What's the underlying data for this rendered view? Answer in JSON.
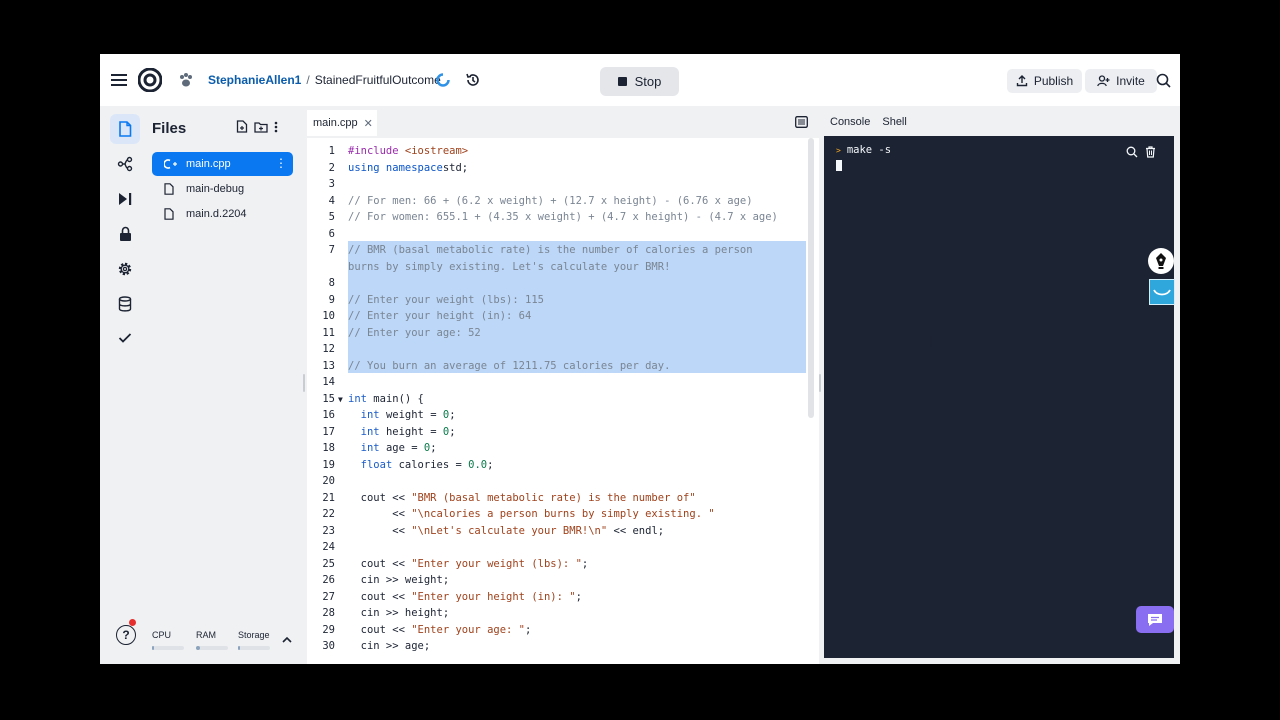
{
  "header": {
    "user": "StephanieAllen1",
    "separator": "/",
    "repl_name": "StainedFruitfulOutcome",
    "stop_label": "Stop",
    "publish_label": "Publish",
    "invite_label": "Invite"
  },
  "files": {
    "title": "Files",
    "items": [
      {
        "name": "main.cpp",
        "selected": true,
        "icon": "cpp-icon"
      },
      {
        "name": "main-debug",
        "selected": false,
        "icon": "file-icon"
      },
      {
        "name": "main.d.2204",
        "selected": false,
        "icon": "file-icon"
      }
    ]
  },
  "resources": {
    "cpu_label": "CPU",
    "ram_label": "RAM",
    "storage_label": "Storage",
    "cpu": 0.05,
    "ram": 0.12,
    "storage": 0.05
  },
  "editor": {
    "tab_label": "main.cpp",
    "selected_lines": [
      7,
      8,
      9,
      10,
      11,
      12,
      13
    ],
    "lines": [
      {
        "n": "1",
        "segs": [
          [
            "pp",
            "#include "
          ],
          [
            "st",
            "<iostream>"
          ]
        ]
      },
      {
        "n": "2",
        "segs": [
          [
            "kw",
            "using namespace"
          ],
          [
            "",
            "std;"
          ]
        ]
      },
      {
        "n": "3",
        "segs": []
      },
      {
        "n": "4",
        "segs": [
          [
            "cm",
            "// For men: 66 + (6.2 x weight) + (12.7 x height) - (6.76 x age)"
          ]
        ]
      },
      {
        "n": "5",
        "segs": [
          [
            "cm",
            "// For women: 655.1 + (4.35 x weight) + (4.7 x height) - (4.7 x age)"
          ]
        ]
      },
      {
        "n": "6",
        "segs": []
      },
      {
        "n": "7",
        "segs": [
          [
            "cm",
            "// BMR (basal metabolic rate) is the number of calories a person"
          ]
        ]
      },
      {
        "n": "",
        "segs": [
          [
            "cm",
            "burns by simply existing. Let's calculate your BMR!"
          ]
        ]
      },
      {
        "n": "8",
        "segs": []
      },
      {
        "n": "9",
        "segs": [
          [
            "cm",
            "// Enter your weight (lbs): 115"
          ]
        ]
      },
      {
        "n": "10",
        "segs": [
          [
            "cm",
            "// Enter your height (in): 64"
          ]
        ]
      },
      {
        "n": "11",
        "segs": [
          [
            "cm",
            "// Enter your age: 52"
          ]
        ]
      },
      {
        "n": "12",
        "segs": []
      },
      {
        "n": "13",
        "segs": [
          [
            "cm",
            "// You burn an average of 1211.75 calories per day."
          ]
        ]
      },
      {
        "n": "14",
        "segs": []
      },
      {
        "n": "15",
        "segs": [
          [
            "ty",
            "int "
          ],
          [
            "",
            "main() {"
          ]
        ]
      },
      {
        "n": "16",
        "segs": [
          [
            "",
            "  "
          ],
          [
            "ty",
            "int "
          ],
          [
            "",
            "weight = "
          ],
          [
            "nm",
            "0"
          ],
          [
            "",
            ";"
          ]
        ]
      },
      {
        "n": "17",
        "segs": [
          [
            "",
            "  "
          ],
          [
            "ty",
            "int "
          ],
          [
            "",
            "height = "
          ],
          [
            "nm",
            "0"
          ],
          [
            "",
            ";"
          ]
        ]
      },
      {
        "n": "18",
        "segs": [
          [
            "",
            "  "
          ],
          [
            "ty",
            "int "
          ],
          [
            "",
            "age = "
          ],
          [
            "nm",
            "0"
          ],
          [
            "",
            ";"
          ]
        ]
      },
      {
        "n": "19",
        "segs": [
          [
            "",
            "  "
          ],
          [
            "ty",
            "float "
          ],
          [
            "",
            "calories = "
          ],
          [
            "nm",
            "0.0"
          ],
          [
            "",
            ";"
          ]
        ]
      },
      {
        "n": "20",
        "segs": []
      },
      {
        "n": "21",
        "segs": [
          [
            "",
            "  cout << "
          ],
          [
            "st",
            "\"BMR (basal metabolic rate) is the number of\""
          ]
        ]
      },
      {
        "n": "22",
        "segs": [
          [
            "",
            "       << "
          ],
          [
            "st",
            "\"\\ncalories a person burns by simply existing. \""
          ]
        ]
      },
      {
        "n": "23",
        "segs": [
          [
            "",
            "       << "
          ],
          [
            "st",
            "\"\\nLet's calculate your BMR!\\n\""
          ],
          [
            "",
            " << endl;"
          ]
        ]
      },
      {
        "n": "24",
        "segs": []
      },
      {
        "n": "25",
        "segs": [
          [
            "",
            "  cout << "
          ],
          [
            "st",
            "\"Enter your weight (lbs): \""
          ],
          [
            "",
            ";"
          ]
        ]
      },
      {
        "n": "26",
        "segs": [
          [
            "",
            "  cin >> weight;"
          ]
        ]
      },
      {
        "n": "27",
        "segs": [
          [
            "",
            "  cout << "
          ],
          [
            "st",
            "\"Enter your height (in): \""
          ],
          [
            "",
            ";"
          ]
        ]
      },
      {
        "n": "28",
        "segs": [
          [
            "",
            "  cin >> height;"
          ]
        ]
      },
      {
        "n": "29",
        "segs": [
          [
            "",
            "  cout << "
          ],
          [
            "st",
            "\"Enter your age: \""
          ],
          [
            "",
            ";"
          ]
        ]
      },
      {
        "n": "30",
        "segs": [
          [
            "",
            "  cin >> age;"
          ]
        ]
      }
    ]
  },
  "console": {
    "tabs": [
      "Console",
      "Shell"
    ],
    "active_tab": "Console",
    "command": "make -s"
  },
  "colors": {
    "accent": "#0a79f1",
    "console_bg": "#1c2333",
    "selection": "#bcd7f7",
    "chat": "#8a6ef2"
  }
}
